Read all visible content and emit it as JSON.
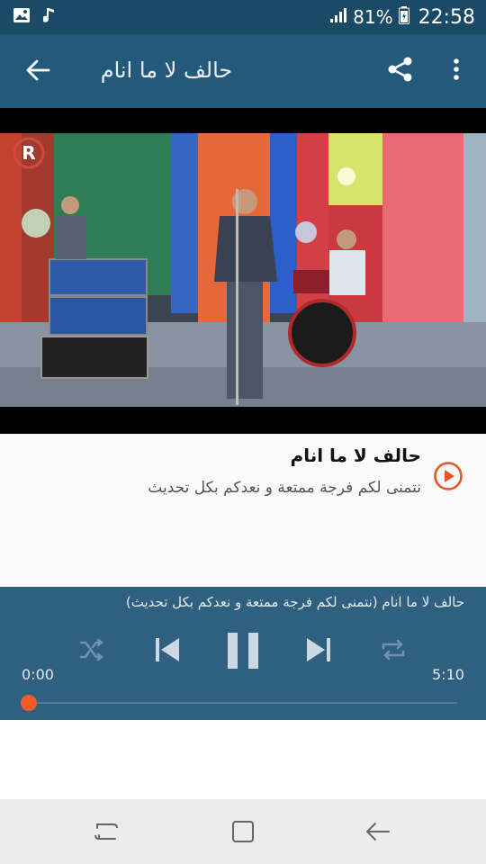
{
  "status_bar": {
    "battery": "81%",
    "time": "22:58",
    "icons": [
      "image-icon",
      "music-note-icon",
      "signal-icon",
      "battery-icon"
    ]
  },
  "app_bar": {
    "title": "حالف لا ما انام",
    "icons": [
      "back-arrow-icon",
      "share-icon",
      "more-vert-icon"
    ]
  },
  "track": {
    "title": "حالف لا ما انام",
    "description": "نتمنى لكم فرجة ممتعة و نعدكم بكل تحديث",
    "play_icon": "play-circle-icon",
    "accent": "#e8552a"
  },
  "player": {
    "now_playing": "حالف لا ما انام (نتمنى لكم فرجة ممتعة و نعدكم بكل تحديث)",
    "time_current": "0:00",
    "time_total": "5:10",
    "progress": 0,
    "controls": [
      "shuffle-icon",
      "previous-icon",
      "pause-icon",
      "next-icon",
      "repeat-icon"
    ],
    "accent": "#f05a28"
  },
  "nav_bar": {
    "icons": [
      "recent-apps-icon",
      "home-icon",
      "back-icon"
    ]
  },
  "colors": {
    "status_bar": "#1b4a66",
    "app_bar": "#235a7b",
    "player": "#2f607f"
  }
}
